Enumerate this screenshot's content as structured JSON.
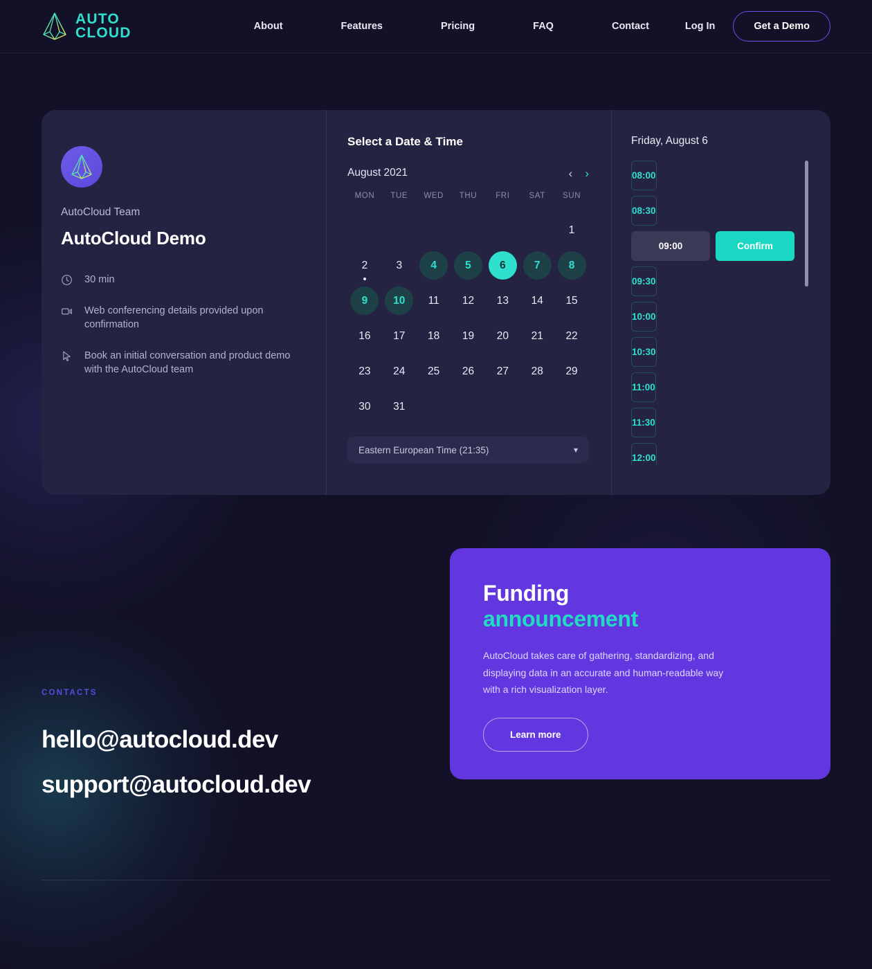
{
  "header": {
    "logo": {
      "line1": "AUTO",
      "line2": "CLOUD",
      "icon": "prism-logo-icon"
    },
    "nav": [
      {
        "label": "About"
      },
      {
        "label": "Features"
      },
      {
        "label": "Pricing"
      },
      {
        "label": "FAQ"
      },
      {
        "label": "Contact"
      }
    ],
    "login_label": "Log In",
    "demo_label": "Get a Demo"
  },
  "booking": {
    "left": {
      "team": "AutoCloud Team",
      "title": "AutoCloud Demo",
      "meta": [
        {
          "icon": "clock-icon",
          "text": "30 min"
        },
        {
          "icon": "video-camera-icon",
          "text": "Web conferencing details provided upon confirmation"
        },
        {
          "icon": "cursor-pointer-icon",
          "text": "Book an initial conversation and product demo with the AutoCloud team"
        }
      ]
    },
    "calendar": {
      "heading": "Select a Date & Time",
      "month": "August 2021",
      "prev_icon": "chevron-left-icon",
      "next_icon": "chevron-right-icon",
      "dow": [
        "MON",
        "TUE",
        "WED",
        "THU",
        "FRI",
        "SAT",
        "SUN"
      ],
      "leading_blanks": 6,
      "days": [
        {
          "n": "1"
        },
        {
          "n": "2",
          "dot": true
        },
        {
          "n": "3"
        },
        {
          "n": "4",
          "state": "avail"
        },
        {
          "n": "5",
          "state": "avail"
        },
        {
          "n": "6",
          "state": "selected"
        },
        {
          "n": "7",
          "state": "avail"
        },
        {
          "n": "8",
          "state": "avail"
        },
        {
          "n": "9",
          "state": "avail"
        },
        {
          "n": "10",
          "state": "avail"
        },
        {
          "n": "11"
        },
        {
          "n": "12"
        },
        {
          "n": "13"
        },
        {
          "n": "14"
        },
        {
          "n": "15"
        },
        {
          "n": "16"
        },
        {
          "n": "17"
        },
        {
          "n": "18"
        },
        {
          "n": "19"
        },
        {
          "n": "20"
        },
        {
          "n": "21"
        },
        {
          "n": "22"
        },
        {
          "n": "23"
        },
        {
          "n": "24"
        },
        {
          "n": "25"
        },
        {
          "n": "26"
        },
        {
          "n": "27"
        },
        {
          "n": "28"
        },
        {
          "n": "29"
        },
        {
          "n": "30"
        },
        {
          "n": "31"
        }
      ],
      "timezone": "Eastern European Time (21:35)",
      "timezone_chevron": "chevron-down-icon"
    },
    "slots": {
      "date_label": "Friday, August 6",
      "items": [
        {
          "time": "08:00",
          "state": "default"
        },
        {
          "time": "08:30",
          "state": "default"
        },
        {
          "time": "09:00",
          "state": "selected",
          "confirm_label": "Confirm"
        },
        {
          "time": "09:30",
          "state": "default"
        },
        {
          "time": "10:00",
          "state": "default"
        },
        {
          "time": "10:30",
          "state": "default"
        },
        {
          "time": "11:00",
          "state": "default"
        },
        {
          "time": "11:30",
          "state": "default"
        },
        {
          "time": "12:00",
          "state": "default"
        }
      ]
    }
  },
  "funding": {
    "title_line1": "Funding",
    "title_line2": "announcement",
    "body": "AutoCloud takes care of gathering, standardizing, and displaying data in an accurate and human-readable way with a rich visualization layer.",
    "cta_label": "Learn more"
  },
  "contacts": {
    "label": "CONTACTS",
    "emails": [
      "hello@autocloud.dev",
      "support@autocloud.dev"
    ]
  },
  "colors": {
    "page_bg": "#121127",
    "card_bg": "#242342",
    "accent_teal": "#2fe0cf",
    "accent_purple": "#6237e0",
    "nav_button_border": "#6b4fe8",
    "slot_border": "#235055",
    "avail_day_bg": "#1d4147"
  }
}
